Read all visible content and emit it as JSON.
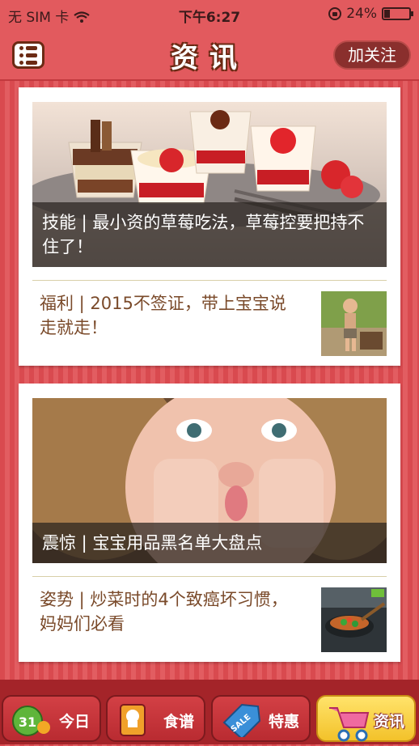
{
  "status_bar": {
    "carrier": "无 SIM 卡",
    "time": "下午6:27",
    "battery": "24%"
  },
  "nav": {
    "title": "资讯",
    "follow_label": "加关注"
  },
  "articles": [
    {
      "headline": "技能 | 最小资的草莓吃法，草莓控要把持不住了！",
      "secondary": "福利 | 2015不签证，带上宝宝说走就走！"
    },
    {
      "headline": "震惊 | 宝宝用品黑名单大盘点",
      "secondary": "姿势 | 炒菜时的4个致癌坏习惯，妈妈们必看"
    }
  ],
  "tabs": [
    {
      "label": "今日",
      "icon": "calendar-31-icon",
      "badge": "31",
      "active": false
    },
    {
      "label": "食谱",
      "icon": "chef-book-icon",
      "active": false
    },
    {
      "label": "特惠",
      "icon": "sale-tag-icon",
      "badge": "SALE",
      "active": false
    },
    {
      "label": "资讯",
      "icon": "stroller-icon",
      "active": true
    }
  ],
  "colors": {
    "brand_red": "#e25a5e",
    "tab_bar": "#a42429",
    "active_tab": "#f3c22a",
    "text_brown": "#7a4a2a"
  }
}
